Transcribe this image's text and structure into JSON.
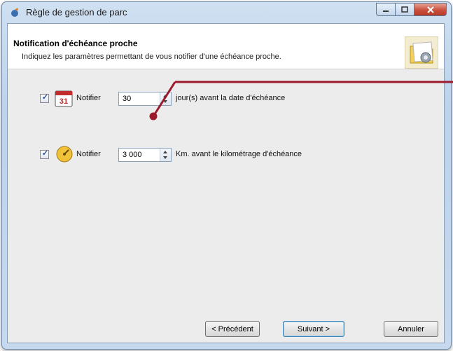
{
  "window": {
    "title": "Règle de gestion de parc"
  },
  "header": {
    "title": "Notification d'échéance proche",
    "subtitle": "Indiquez les paramètres permettant de vous notifier d'une échéance proche."
  },
  "rows": [
    {
      "checked": true,
      "icon": "calendar-icon",
      "icon_text": "31",
      "label": "Notifier",
      "value": "30",
      "suffix": "jour(s) avant la date d'échéance"
    },
    {
      "checked": true,
      "icon": "odometer-icon",
      "label": "Notifier",
      "value": "3 000",
      "suffix": "Km. avant le kilométrage d'échéance"
    }
  ],
  "buttons": {
    "prev": "< Précédent",
    "next": "Suivant >",
    "cancel": "Annuler"
  },
  "colors": {
    "annotation": "#9b1b2c"
  }
}
